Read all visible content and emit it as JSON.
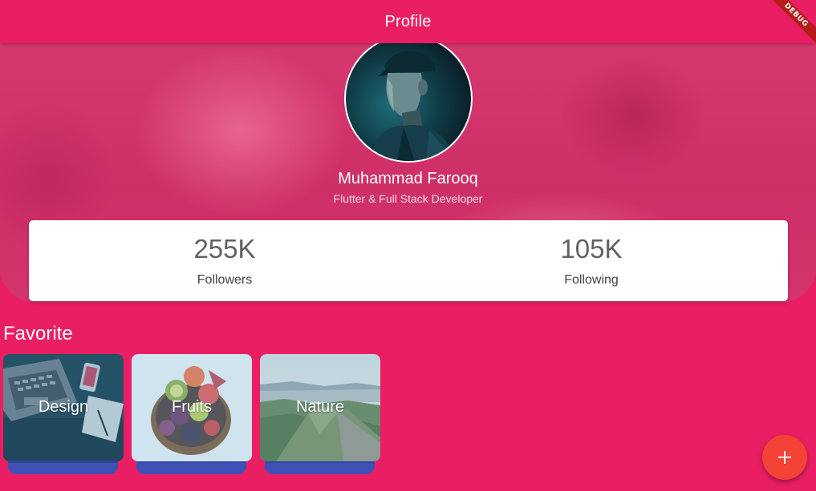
{
  "app_bar": {
    "title": "Profile",
    "debug_banner": "DEBUG"
  },
  "profile": {
    "name": "Muhammad Farooq",
    "subtitle": "Flutter & Full Stack Developer"
  },
  "stats": [
    {
      "value": "255K",
      "label": "Followers"
    },
    {
      "value": "105K",
      "label": "Following"
    }
  ],
  "favorites": {
    "title": "Favorite",
    "items": [
      {
        "label": "Design"
      },
      {
        "label": "Fruits"
      },
      {
        "label": "Nature"
      }
    ]
  },
  "fab": {
    "icon": "add-icon"
  },
  "colors": {
    "primary": "#E91E63",
    "fab": "#F44336",
    "card": "#FFFFFF",
    "favorite_base": "#3F51B5"
  }
}
